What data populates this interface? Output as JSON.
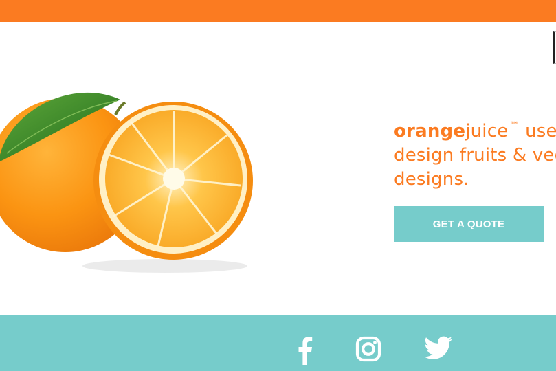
{
  "header": {
    "bar_color": "#fb7b21"
  },
  "hero": {
    "image_icon": "orange-fruit-image",
    "tagline": {
      "brand_part1": "orange",
      "brand_part2": "juice",
      "trademark": "™",
      "line1_rest": " uses",
      "line2": "design fruits & veg",
      "line3": "designs."
    },
    "cta_label": "GET A QUOTE"
  },
  "footer": {
    "background": "#76cccb",
    "social_icons": [
      "facebook-icon",
      "instagram-icon",
      "twitter-icon"
    ]
  }
}
